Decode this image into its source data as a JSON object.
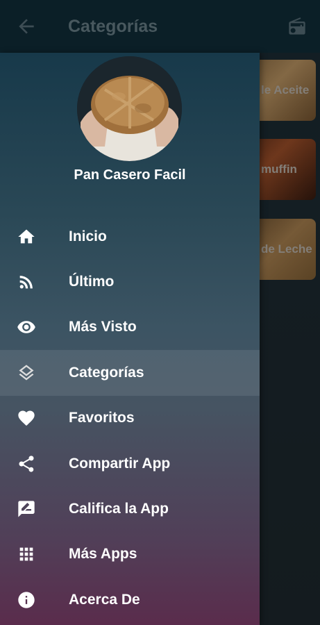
{
  "appbar": {
    "title": "Categorías",
    "back_icon": "arrow-left-icon",
    "radio_icon": "radio-icon"
  },
  "background_categories": [
    {
      "label": "le Aceite"
    },
    {
      "label": "muffin"
    },
    {
      "label": "de Leche"
    }
  ],
  "drawer": {
    "app_name": "Pan Casero Facil",
    "menu": [
      {
        "label": "Inicio",
        "icon": "home-icon"
      },
      {
        "label": "Último",
        "icon": "rss-icon"
      },
      {
        "label": "Más Visto",
        "icon": "eye-icon"
      },
      {
        "label": "Categorías",
        "icon": "layers-icon",
        "active": true
      },
      {
        "label": "Favoritos",
        "icon": "heart-icon"
      },
      {
        "label": "Compartir App",
        "icon": "share-icon"
      },
      {
        "label": "Califica la App",
        "icon": "rate-review-icon"
      },
      {
        "label": "Más Apps",
        "icon": "grid-icon"
      },
      {
        "label": "Acerca De",
        "icon": "info-icon"
      }
    ]
  },
  "colors": {
    "appbar": "#12303d",
    "drawer_top": "#17394a",
    "drawer_bottom": "#5a2c4c",
    "text": "#ffffff"
  }
}
